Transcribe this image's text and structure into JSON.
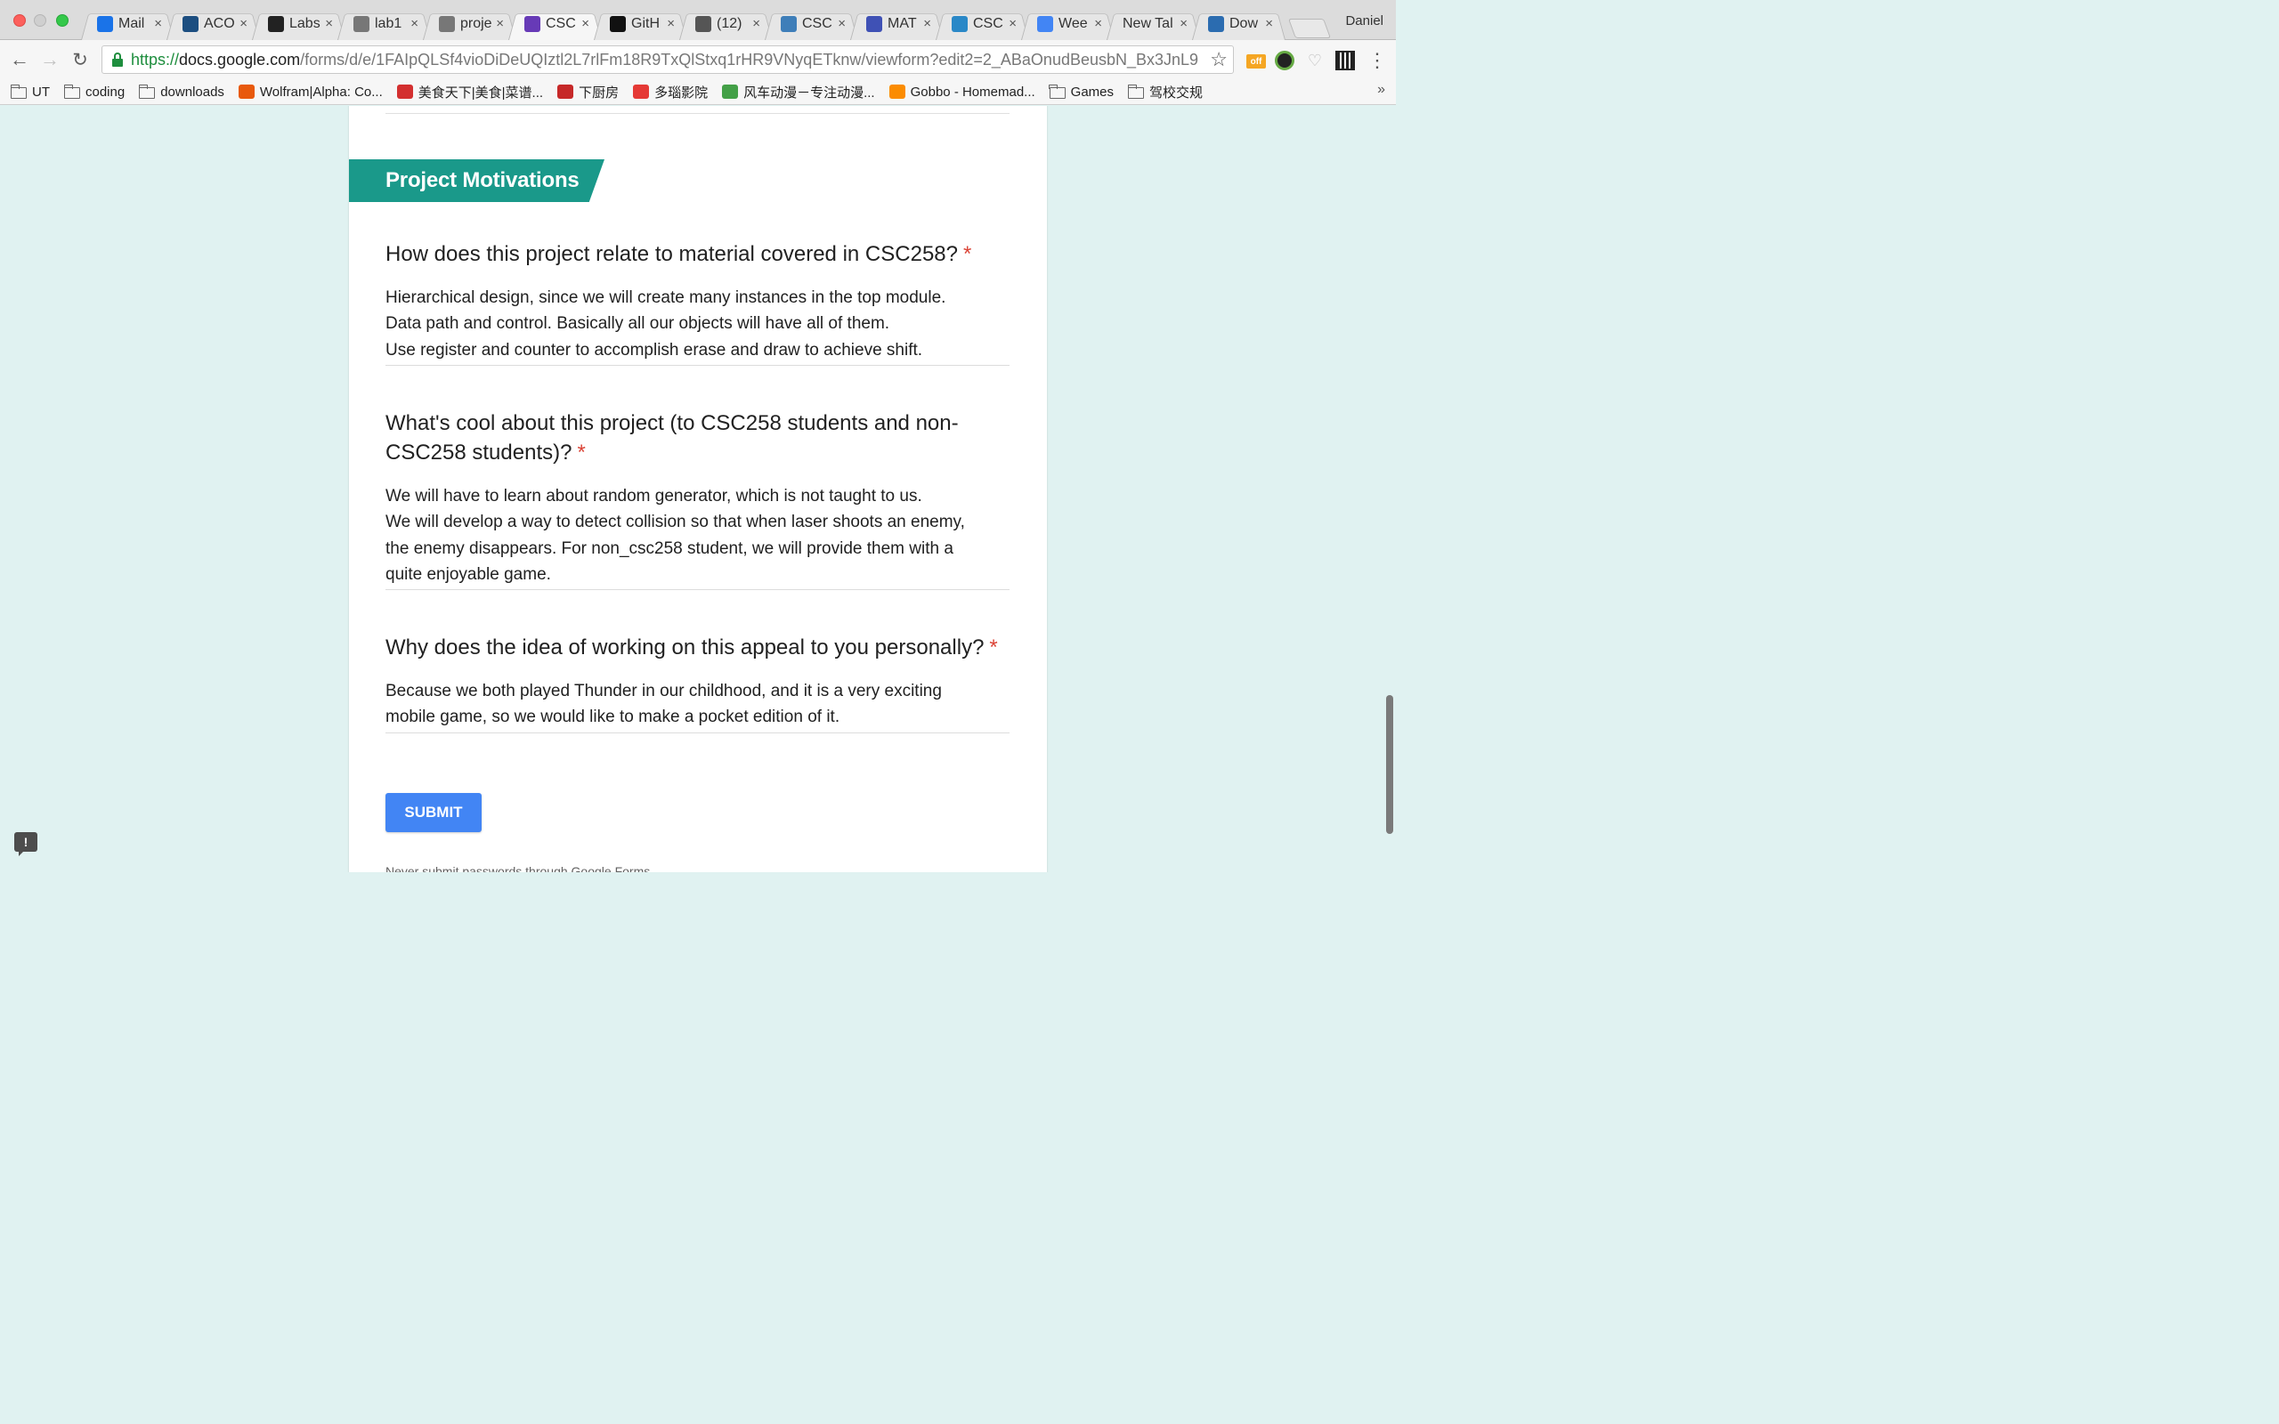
{
  "browser": {
    "profile_name": "Daniel",
    "tabs": [
      {
        "title": "Mail",
        "icon": "mail-icon",
        "color": "#1a73e8"
      },
      {
        "title": "ACO",
        "icon": "crest-icon",
        "color": "#1c4e80"
      },
      {
        "title": "Labs",
        "icon": "blackboard-icon",
        "color": "#222222"
      },
      {
        "title": "lab1",
        "icon": "document-icon",
        "color": "#777777"
      },
      {
        "title": "proje",
        "icon": "document-icon",
        "color": "#777777"
      },
      {
        "title": "CSC",
        "icon": "forms-icon",
        "color": "#673ab7",
        "active": true
      },
      {
        "title": "GitH",
        "icon": "github-icon",
        "color": "#111111"
      },
      {
        "title": "(12)",
        "icon": "chat-icon",
        "color": "#555555"
      },
      {
        "title": "CSC",
        "icon": "piazza-icon",
        "color": "#3e7eb9"
      },
      {
        "title": "MAT",
        "icon": "shield-crest-icon",
        "color": "#3f51b5"
      },
      {
        "title": "CSC",
        "icon": "snowflake-icon",
        "color": "#2a88c7"
      },
      {
        "title": "Wee",
        "icon": "docs-icon",
        "color": "#4285f4"
      },
      {
        "title": "New Tal",
        "icon": "none"
      },
      {
        "title": "Dow",
        "icon": "chart-icon",
        "color": "#2b6cb0"
      }
    ],
    "url": {
      "scheme": "https://",
      "host": "docs.google.com",
      "path": "/forms/d/e/1FAIpQLSf4vioDiDeUQIztl2L7rlFm18R9TxQlStxq1rHR9VNyqETknw/viewform?edit2=2_ABaOnudBeusbN_Bx3JnL9..."
    },
    "extensions": {
      "off_label": "off"
    },
    "bookmarks": [
      {
        "label": "UT",
        "type": "folder"
      },
      {
        "label": "coding",
        "type": "folder"
      },
      {
        "label": "downloads",
        "type": "folder"
      },
      {
        "label": "Wolfram|Alpha: Co...",
        "type": "site",
        "icon": "wolfram-icon",
        "color": "#e8590c"
      },
      {
        "label": "美食天下|美食|菜谱...",
        "type": "site",
        "icon": "meishi-icon",
        "color": "#d32f2f"
      },
      {
        "label": "下厨房",
        "type": "site",
        "icon": "xiachufang-icon",
        "color": "#c62828"
      },
      {
        "label": "多瑙影院",
        "type": "site",
        "icon": "duonao-icon",
        "color": "#e53935"
      },
      {
        "label": "风车动漫－专注动漫...",
        "type": "site",
        "icon": "pinwheel-icon",
        "color": "#43a047"
      },
      {
        "label": "Gobbo - Homemad...",
        "type": "site",
        "icon": "gobbo-icon",
        "color": "#fb8c00"
      },
      {
        "label": "Games",
        "type": "folder"
      },
      {
        "label": "驾校交规",
        "type": "folder"
      }
    ],
    "bookmarks_overflow": "»"
  },
  "form": {
    "section_title": "Project Motivations",
    "questions": [
      {
        "title": "How does this project relate to material covered in CSC258?",
        "required_marker": "*",
        "answer_lines": [
          "Hierarchical design, since we will create many instances in the top module.",
          "Data path and control. Basically all our objects will have all of them.",
          "Use register and counter to accomplish erase and draw to achieve shift."
        ]
      },
      {
        "title": "What's cool about this project (to CSC258 students and non-CSC258 students)?",
        "title_lines": [
          "What's cool about this project (to CSC258 students and non-",
          "CSC258 students)?"
        ],
        "required_marker": "*",
        "answer_lines": [
          "We will have to learn about random generator, which is not taught to us.",
          "We will develop a way to detect collision so that when laser shoots an enemy,",
          "the enemy disappears. For non_csc258 student, we will provide them with a",
          "quite enjoyable game."
        ]
      },
      {
        "title": "Why does the idea of working on this appeal to you personally?",
        "required_marker": "*",
        "answer_lines": [
          "Because we both played Thunder in our childhood, and it is a very exciting",
          "mobile game, so we would like to make a pocket edition of it."
        ]
      }
    ],
    "submit_label": "SUBMIT",
    "password_note": "Never submit passwords through Google Forms.",
    "feedback_label": "!"
  },
  "colors": {
    "page_bg": "#e0f2f1",
    "section_band": "#1a998a",
    "required": "#db4437",
    "submit": "#4285f4"
  }
}
